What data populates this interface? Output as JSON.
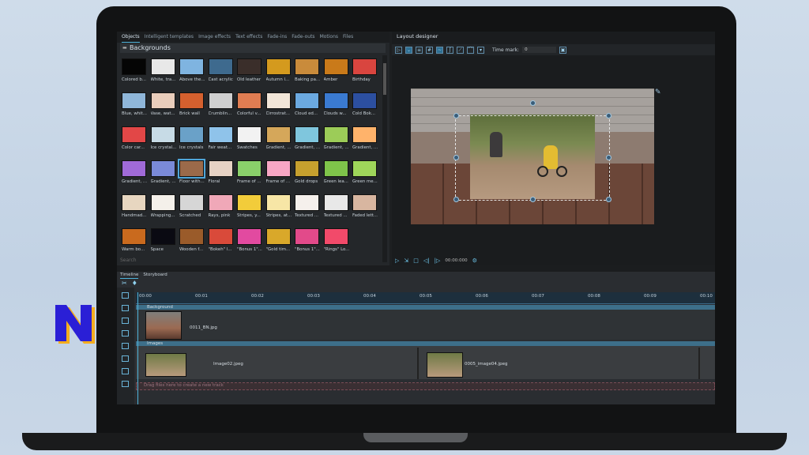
{
  "object_tabs": [
    "Objects",
    "Intelligent templates",
    "Image effects",
    "Text effects",
    "Fade-ins",
    "Fade-outs",
    "Motions",
    "Files"
  ],
  "section_title": "Backgrounds",
  "search_placeholder": "Search",
  "thumbnails": [
    {
      "label": "Colored b...",
      "color": "#050505"
    },
    {
      "label": "White, tra...",
      "color": "#e8e8e8"
    },
    {
      "label": "Above the...",
      "color": "#7fb4e0"
    },
    {
      "label": "Cast acrylic",
      "color": "#3e6a8e"
    },
    {
      "label": "Old leather",
      "color": "#3a2e2a"
    },
    {
      "label": "Autumn l...",
      "color": "#d49a1e"
    },
    {
      "label": "Baking pa...",
      "color": "#c98b3b"
    },
    {
      "label": "Amber",
      "color": "#c97a1a"
    },
    {
      "label": "Birthday",
      "color": "#d9453f"
    },
    {
      "label": "Blue, whit...",
      "color": "#8fb6d9"
    },
    {
      "label": "Vase, wat...",
      "color": "#e9cdbb"
    },
    {
      "label": "Brick wall",
      "color": "#d5602e"
    },
    {
      "label": "Crumblin...",
      "color": "#cfcfcf"
    },
    {
      "label": "Colorful v...",
      "color": "#e07d52"
    },
    {
      "label": "Cirrostrat...",
      "color": "#f2e6d8"
    },
    {
      "label": "Cloud ed...",
      "color": "#6ba9e0"
    },
    {
      "label": "Clouds w...",
      "color": "#3a7ad1"
    },
    {
      "label": "Cold Bok...",
      "color": "#2c4fa0"
    },
    {
      "label": "Color car...",
      "color": "#e24747"
    },
    {
      "label": "Ice crystal...",
      "color": "#c7dbe6"
    },
    {
      "label": "Ice crystals",
      "color": "#6aa1c8"
    },
    {
      "label": "Fair weat...",
      "color": "#8fc3ea"
    },
    {
      "label": "Swatches",
      "color": "#f2f2f2"
    },
    {
      "label": "Gradient, ...",
      "color": "#d5a75a"
    },
    {
      "label": "Gradient, ...",
      "color": "#7fc6dd"
    },
    {
      "label": "Gradient, ...",
      "color": "#9ccc58"
    },
    {
      "label": "Gradient, ...",
      "color": "#ffb36b"
    },
    {
      "label": "Gradient, ...",
      "color": "#a06ad8"
    },
    {
      "label": "Gradient, ...",
      "color": "#7a8ad8"
    },
    {
      "label": "Floor with...",
      "color": "#9b6a4a"
    },
    {
      "label": "Floral",
      "color": "#e6d2c4"
    },
    {
      "label": "Frame of ...",
      "color": "#8ad06a"
    },
    {
      "label": "Frame of ...",
      "color": "#f7a6c4"
    },
    {
      "label": "Gold drops",
      "color": "#c6a02e"
    },
    {
      "label": "Green lea...",
      "color": "#7fc44a"
    },
    {
      "label": "Green me...",
      "color": "#9fd65a"
    },
    {
      "label": "Handmad...",
      "color": "#e7d6c0"
    },
    {
      "label": "Wrapping...",
      "color": "#f4f0ea"
    },
    {
      "label": "Scratched",
      "color": "#d6d6d6"
    },
    {
      "label": "Rays, pink",
      "color": "#f0a8b8"
    },
    {
      "label": "Stripes, y...",
      "color": "#f2cc3a"
    },
    {
      "label": "Stripes, at...",
      "color": "#f7e6a6"
    },
    {
      "label": "Textured ...",
      "color": "#f5f0ec"
    },
    {
      "label": "Textured ...",
      "color": "#e8e8e8"
    },
    {
      "label": "Faded lett...",
      "color": "#d8b6a0"
    },
    {
      "label": "Warm bo...",
      "color": "#c96a1e"
    },
    {
      "label": "Space",
      "color": "#0a0a12"
    },
    {
      "label": "Wooden f...",
      "color": "#9a5b2a"
    },
    {
      "label": "\"Bokeh\" l...",
      "color": "#d94a3a"
    },
    {
      "label": "\"Bonus 1\"...",
      "color": "#e24aa0"
    },
    {
      "label": "\"Gold tim...",
      "color": "#d9a82a"
    },
    {
      "label": "\"Bonus 1\"...",
      "color": "#e24a8a"
    },
    {
      "label": "\"Rings\" Lo...",
      "color": "#f24a6a"
    }
  ],
  "layout_designer": {
    "title": "Layout designer",
    "time_mark_label": "Time mark:",
    "time_mark_value": "0"
  },
  "preview_time": "00:00:000",
  "timeline": {
    "tabs": [
      "Timeline",
      "Storyboard"
    ],
    "ticks": [
      "00:00",
      "00:01",
      "00:02",
      "00:03",
      "00:04",
      "00:05",
      "00:06",
      "00:07",
      "00:08",
      "00:09",
      "00:10"
    ],
    "track1_label": "Background",
    "clip1_name": "0011_BN.jpg",
    "track2_label": "Images",
    "clip2_name": "Image02.jpeg",
    "clip3_name": "0005_image04.jpeg",
    "track3_label": "Drag files here to create a new track"
  },
  "colors": {
    "accent": "#4fb3d9",
    "logo_fill": "#2a1fd6",
    "logo_shadow": "#f4ad1e"
  }
}
